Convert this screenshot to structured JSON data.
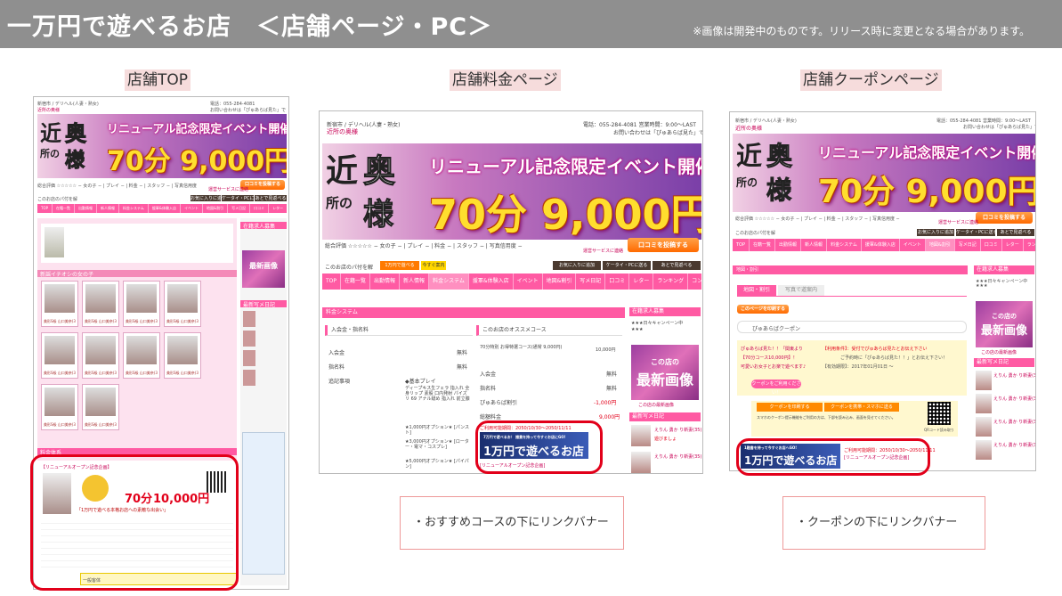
{
  "header": {
    "title": "一万円で遊べるお店　＜店舗ページ・PC＞",
    "note": "※画像は開発中のものです。リリース時に変更となる場合があります。"
  },
  "sections": {
    "top": "店舗TOP",
    "price": "店舗料金ページ",
    "coupon": "店舗クーポンページ"
  },
  "shop": {
    "breadcrumb": "新宿市 / デリヘル(人妻・熟女)",
    "name": "近所の奥様",
    "phone": "電話：055-284-4081",
    "hours": "営業時間：9:00〜LAST",
    "contact_note": "お問い合わせは「ぴゅあらば見た」で！",
    "banner_kanji_1": "近",
    "banner_kanji_2": "所の",
    "banner_kanji_3": "奥",
    "banner_kanji_4": "様",
    "banner_renewal": "リニューアル記念限定イベント開催",
    "banner_price": "70分 9,000円〜",
    "rating_line": "総合評価 ☆☆☆☆☆ − 女の子 − | プレイ − | 料金 − | スタッフ − | 写真信用度 −",
    "service_link": "運営サービスに連絡",
    "post_review": "口コミを投稿する",
    "fav_label": "このお店のパ付を解",
    "fav_badge": "1万円で遊べる",
    "fav_badge2": "今すぐ案内",
    "btn_fav": "お気に入りに追加",
    "btn_mobile": "ケータイ・PCに送る",
    "btn_later": "あとで見返べる"
  },
  "nav": [
    "TOP",
    "在籍一覧",
    "出勤情報",
    "新人情報",
    "料金システム",
    "援軍&体験入店",
    "イベント",
    "地図&割引",
    "写メ日記",
    "口コミ",
    "レター",
    "ランキング",
    "コンテンツ"
  ],
  "top_page": {
    "new_girls_head": "新謡イチオシの女の子",
    "price_head": "料金体系",
    "renewal_head": "【リニューアルオープン記念企画】",
    "deal_price": "70分",
    "deal_price2": "10,000円",
    "deal_note": "「1万円で遊べる本格お店への素敵な出会い」",
    "service_head": "一般客体",
    "thumb_cap": "美形S級 山口美奈(30)"
  },
  "price_page": {
    "section_head": "料金システム",
    "left_head": "入会金・指名料",
    "rows_left": [
      {
        "label": "入会金",
        "value": "無料"
      },
      {
        "label": "指名料",
        "value": "無料"
      },
      {
        "label": "追記事項",
        "value": "◆基本プレイ"
      }
    ],
    "play_desc": "ディープキス生フェラ 指入れ 全身リップ 素股 口内発射 パイズリ 69 アナル舐め 指入れ 前立腺",
    "option_1": "★1,000円オプション★ [パンスト]",
    "option_2": "★3,000円オプション★ [ローター・電マ・コスプレ]",
    "option_3": "★5,000円オプション★ [パイパン]",
    "right_head": "このお店のオススメコース",
    "course_name": "70分特別 お得特選コース(通常 9,000円)",
    "course_price": "10,000円",
    "rows_right": [
      {
        "label": "入会金",
        "value": "無料"
      },
      {
        "label": "指名料",
        "value": "無料"
      },
      {
        "label": "ぴゅあらば割引",
        "value": "-1,000円"
      },
      {
        "label": "総額料金",
        "value": "9,000円"
      }
    ],
    "period": "ご利用可能期間：2050/10/30〜2050/11/11",
    "banner_small": "7万円で遊べるお！ 諸費を持って今すぐお店にGO!",
    "banner_big": "1万円で遊べるお店",
    "banner_link": "[リニューアルオープン記念企画]",
    "side_head": "在籍求人募集",
    "side_text": "★★★日々キャンペーン中",
    "side_sub": "★★★",
    "newest_1": "この店の",
    "newest_2": "最新画像",
    "newest_link": "この店の最新画像",
    "diary_head": "最新写メ日記",
    "diary_1": "えりん 勇か り新妻(35)",
    "diary_2": "遊びましょ",
    "diary_3": "えりん 勇か り新妻(35)"
  },
  "coupon_page": {
    "section_head": "地図・割引",
    "tab_active": "地図・割引",
    "tab_inactive": "写真で道案内",
    "map_btn": "このページを印刷する",
    "coupon_head": "ぴゅあらばクーポン",
    "coupon_left_1": "ぴゅあらば見た！！「関東より",
    "coupon_left_2": "【70分コース10,000円】！",
    "coupon_left_3": "可愛いお女子とお楽で遊べます♪",
    "coupon_get": "クーポンをご利用ください！",
    "coupon_right_1": "【利用条件】：受付でぴゅあらば見たとお伝え下さい",
    "coupon_right_2": "ご予約時に「ぴゅあらば見た！！」とお伝え下さい！",
    "coupon_right_3": "【有効期限】：2017年01月01日 〜",
    "btn_print": "クーポンを印刷する",
    "btn_send": "クーポンを携帯・スマホに送る",
    "coupon_send_note": "スマホのクーポン提示機能をご利用の方は、下部を読み込み、画面を見せてください。",
    "qr_caption": "QRコード読み取り",
    "banner_small": "1題書を持って今すぐお店へGO!",
    "banner_big": "1万円で遊べるお店",
    "period": "ご利用可能期間：2050/10/30〜2050/11/11",
    "banner_link": "[リニューアルオープン記念企画]"
  },
  "notes": {
    "price": "・おすすめコースの下にリンクバナー",
    "coupon": "・クーポンの下にリンクバナー"
  },
  "colors": {
    "header_bg": "#8f8f8f",
    "label_bg": "#f6dcdc",
    "pink": "#ff5aa3",
    "highlight": "#e2001a",
    "orange": "#ff6a00"
  }
}
